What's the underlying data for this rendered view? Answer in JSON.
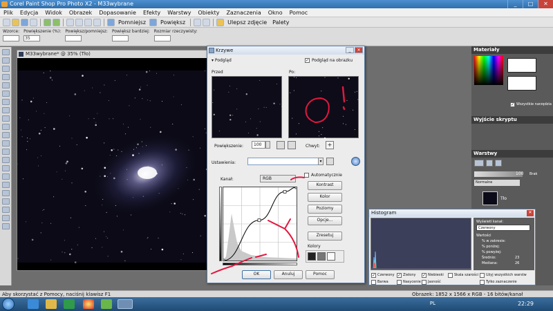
{
  "window": {
    "title": "Corel Paint Shop Pro Photo X2 - M33wybrane",
    "controls": [
      "_",
      "□",
      "✕"
    ]
  },
  "menu": [
    "Plik",
    "Edycja",
    "Widok",
    "Obrazek",
    "Dopasowanie",
    "Efekty",
    "Warstwy",
    "Obiekty",
    "Zaznaczenia",
    "Okno",
    "Pomoc"
  ],
  "toolbar": {
    "less_label": "Pomniejsz",
    "more_label": "Powiększ",
    "enhance_label": "Ulepsz zdjęcie",
    "palettes_label": "Palety"
  },
  "options": [
    {
      "label": "Wzorce:",
      "value": ""
    },
    {
      "label": "Powiększenie (%):",
      "value": "35"
    },
    {
      "label": "Powiększ/pomniejsz:",
      "value": ""
    },
    {
      "label": "Powiększ bardziej:",
      "value": ""
    },
    {
      "label": "Rozmiar rzeczywisty:",
      "value": ""
    }
  ],
  "image_window": {
    "title": "M33wybrane* @ 35% (Tło)"
  },
  "curves": {
    "title": "Krzywe",
    "preview_toggle": "Podgląd",
    "on_image": "Podgląd na obrazku",
    "before": "Przed",
    "after": "Po:",
    "zoom_label": "Powiększenie:",
    "zoom_value": "100",
    "grab_label": "Chwyt:",
    "settings_label": "Ustawienia:",
    "channel_label": "Kanał:",
    "channel_value": "RGB",
    "auto_label": "Automatycznie",
    "buttons": {
      "contrast": "Kontrast",
      "color": "Kolor",
      "levels": "Poziomy",
      "options": "Opcje...",
      "reset": "Zresetuj",
      "ok": "OK",
      "cancel": "Anuluj",
      "help": "Pomoc"
    },
    "colors_label": "Kolory",
    "curve_points": [
      [
        0,
        0
      ],
      [
        0.49,
        0.55
      ],
      [
        0.84,
        0.94
      ],
      [
        1,
        1
      ]
    ]
  },
  "histogram": {
    "title": "Histogram",
    "channel_label": "Wyświetl kanał:",
    "channel_value": "Czerwony",
    "values_label": "Wartości",
    "rows": [
      {
        "label": "% w zakresie:",
        "value": ""
      },
      {
        "label": "% poniżej:",
        "value": ""
      },
      {
        "label": "% powyżej:",
        "value": ""
      },
      {
        "label": "Średnio:",
        "value": "23"
      },
      {
        "label": "Mediana:",
        "value": "26"
      }
    ],
    "checks": [
      "Czerwony",
      "Zielony",
      "Niebieski",
      "Skala szarości",
      "Użyj wszystkich warstw",
      "Barwa",
      "Nasycenie",
      "Jasność",
      "Tylko zaznaczenie"
    ]
  },
  "panels": {
    "materials": "Materiały",
    "all_tools": "Wszystkie narzędzia",
    "script": "Wyjście skryptu",
    "layers": "Warstwy",
    "opacity": "100",
    "blend": "Normalne",
    "brak": "Brak",
    "layer_name": "Tło"
  },
  "status": {
    "hint": "Aby skorzystać z Pomocy, naciśnij klawisz F1",
    "image_info": "Obrazek: 1852 x 1566 x RGB - 16 bitów/kanał"
  },
  "taskbar": {
    "lang": "PL",
    "time": "22:29"
  },
  "colors": {
    "annotation": "#e3173f",
    "title_blue": "#2f6fae"
  }
}
